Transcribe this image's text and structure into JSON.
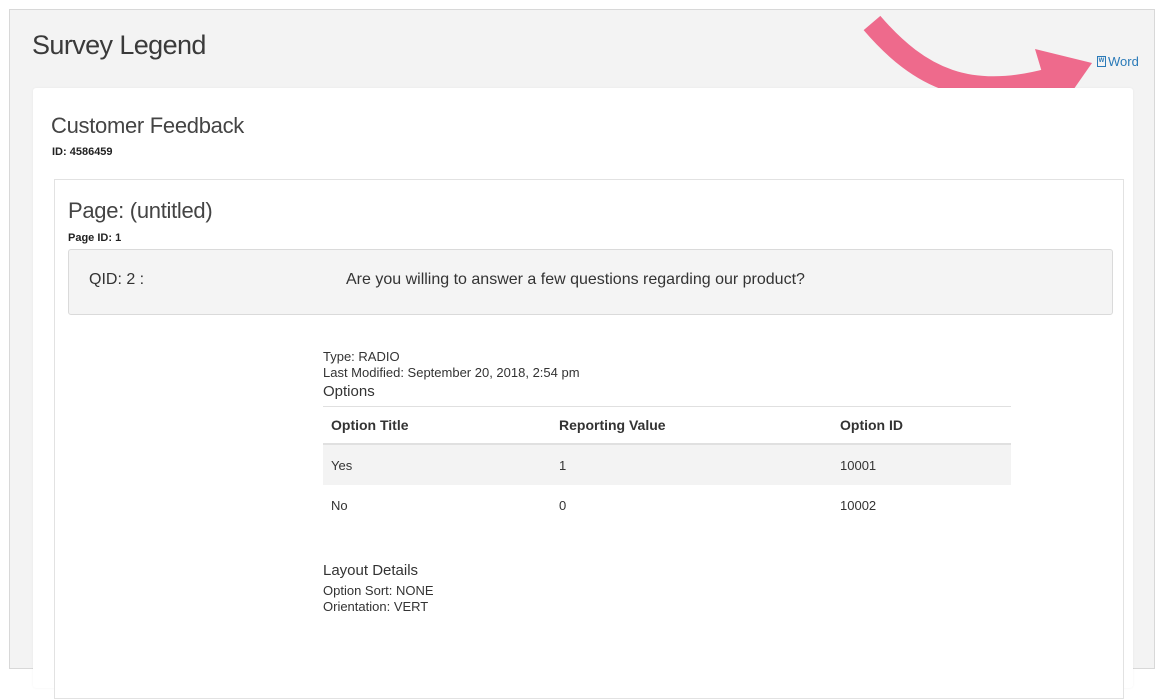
{
  "header": {
    "title": "Survey Legend",
    "export_word_label": "Word",
    "export_word_icon": "word-document-icon"
  },
  "survey": {
    "name": "Customer Feedback",
    "id_label": "ID: 4586459"
  },
  "page": {
    "name": "Page: (untitled)",
    "id_label": "Page ID: 1"
  },
  "question": {
    "qid_label": "QID: 2 :",
    "text": "Are you willing to answer a few questions regarding our product?",
    "type_label": "Type: RADIO",
    "last_modified_label": "Last Modified: September 20, 2018, 2:54 pm"
  },
  "options": {
    "heading": "Options",
    "columns": [
      "Option Title",
      "Reporting Value",
      "Option ID"
    ],
    "rows": [
      [
        "Yes",
        "1",
        "10001"
      ],
      [
        "No",
        "0",
        "10002"
      ]
    ]
  },
  "layout": {
    "heading": "Layout Details",
    "option_sort_label": "Option Sort: NONE",
    "orientation_label": "Orientation: VERT"
  },
  "colors": {
    "link": "#2a7ab8",
    "annotation_arrow": "#ee6a8c",
    "row_shade": "#f3f3f3"
  }
}
